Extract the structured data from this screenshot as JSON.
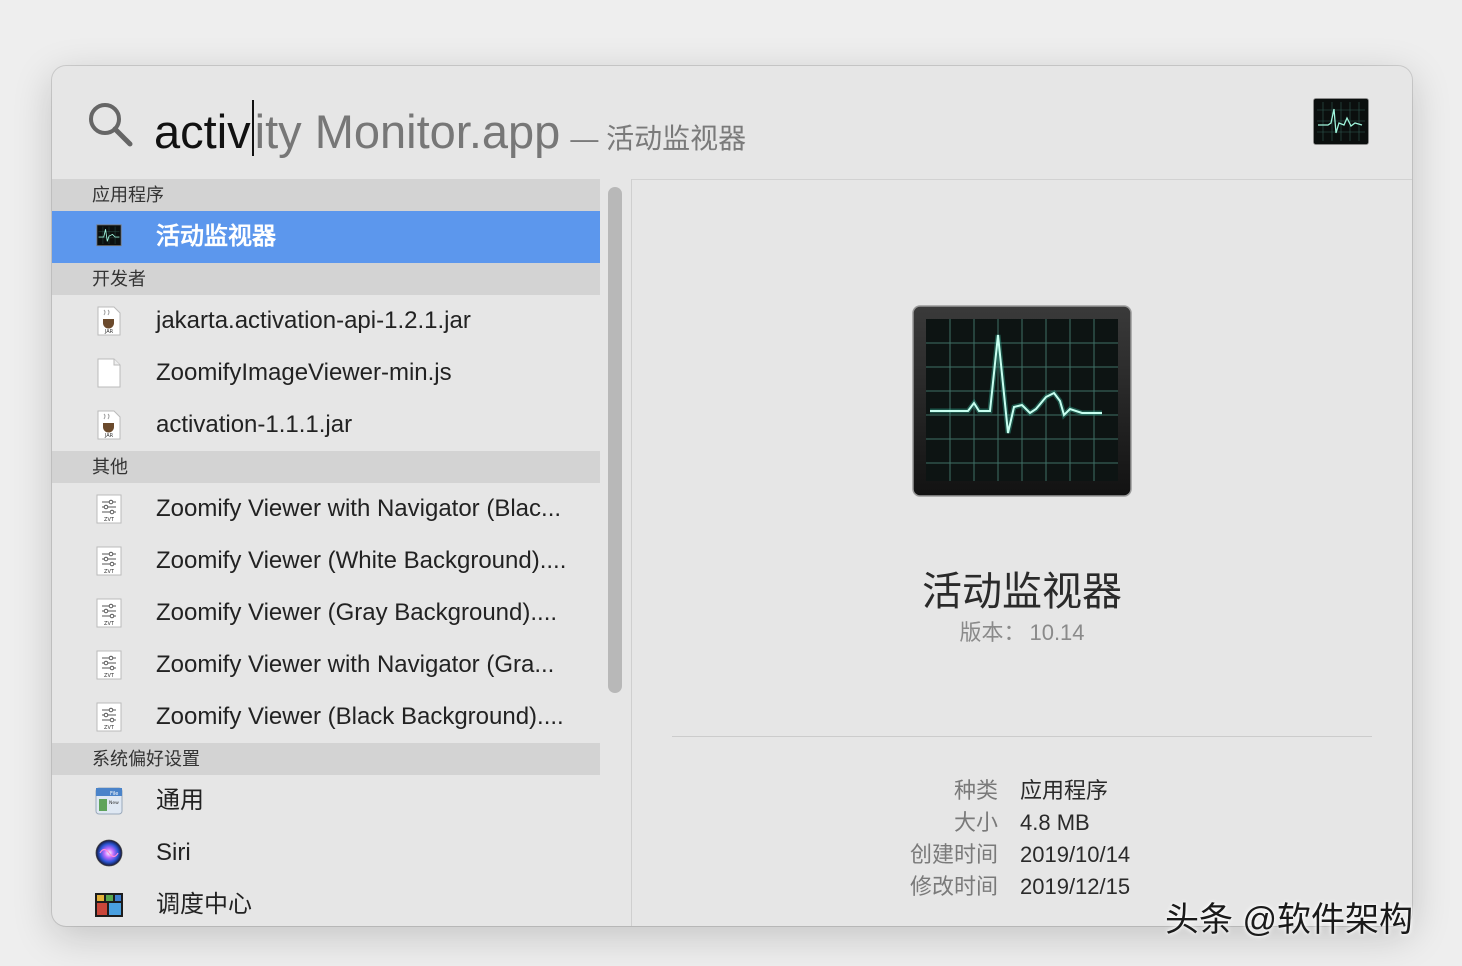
{
  "search": {
    "typed": "activ",
    "typed_after_caret": "ity",
    "completion": " Monitor.app",
    "subtitle": "— 活动监视器",
    "top_icon": "activity-monitor-icon"
  },
  "results": {
    "sections": [
      {
        "header": "应用程序",
        "items": [
          {
            "label": "活动监视器",
            "icon": "activity-monitor-icon",
            "selected": true
          }
        ]
      },
      {
        "header": "开发者",
        "items": [
          {
            "label": "jakarta.activation-api-1.2.1.jar",
            "icon": "jar-file-icon"
          },
          {
            "label": "ZoomifyImageViewer-min.js",
            "icon": "document-icon"
          },
          {
            "label": "activation-1.1.1.jar",
            "icon": "jar-file-icon"
          }
        ]
      },
      {
        "header": "其他",
        "items": [
          {
            "label": "Zoomify Viewer with Navigator (Blac...",
            "icon": "zvt-file-icon"
          },
          {
            "label": "Zoomify Viewer (White Background)....",
            "icon": "zvt-file-icon"
          },
          {
            "label": "Zoomify Viewer (Gray Background)....",
            "icon": "zvt-file-icon"
          },
          {
            "label": "Zoomify Viewer with Navigator (Gra...",
            "icon": "zvt-file-icon"
          },
          {
            "label": "Zoomify Viewer (Black Background)....",
            "icon": "zvt-file-icon"
          }
        ]
      },
      {
        "header": "系统偏好设置",
        "items": [
          {
            "label": "通用",
            "icon": "general-prefs-icon"
          },
          {
            "label": "Siri",
            "icon": "siri-icon"
          },
          {
            "label": "调度中心",
            "icon": "mission-control-icon"
          }
        ]
      }
    ]
  },
  "preview": {
    "icon": "activity-monitor-icon",
    "name": "活动监视器",
    "version_label": "版本：",
    "version": "10.14",
    "meta": [
      {
        "key": "种类",
        "value": "应用程序"
      },
      {
        "key": "大小",
        "value": "4.8 MB"
      },
      {
        "key": "创建时间",
        "value": "2019/10/14"
      },
      {
        "key": "修改时间",
        "value": "2019/12/15"
      }
    ]
  },
  "colors": {
    "selection": "#5c97ed",
    "section_header_bg": "#d3d3d3",
    "window_bg": "#e6e6e6"
  },
  "watermark": "头条 @软件架构"
}
